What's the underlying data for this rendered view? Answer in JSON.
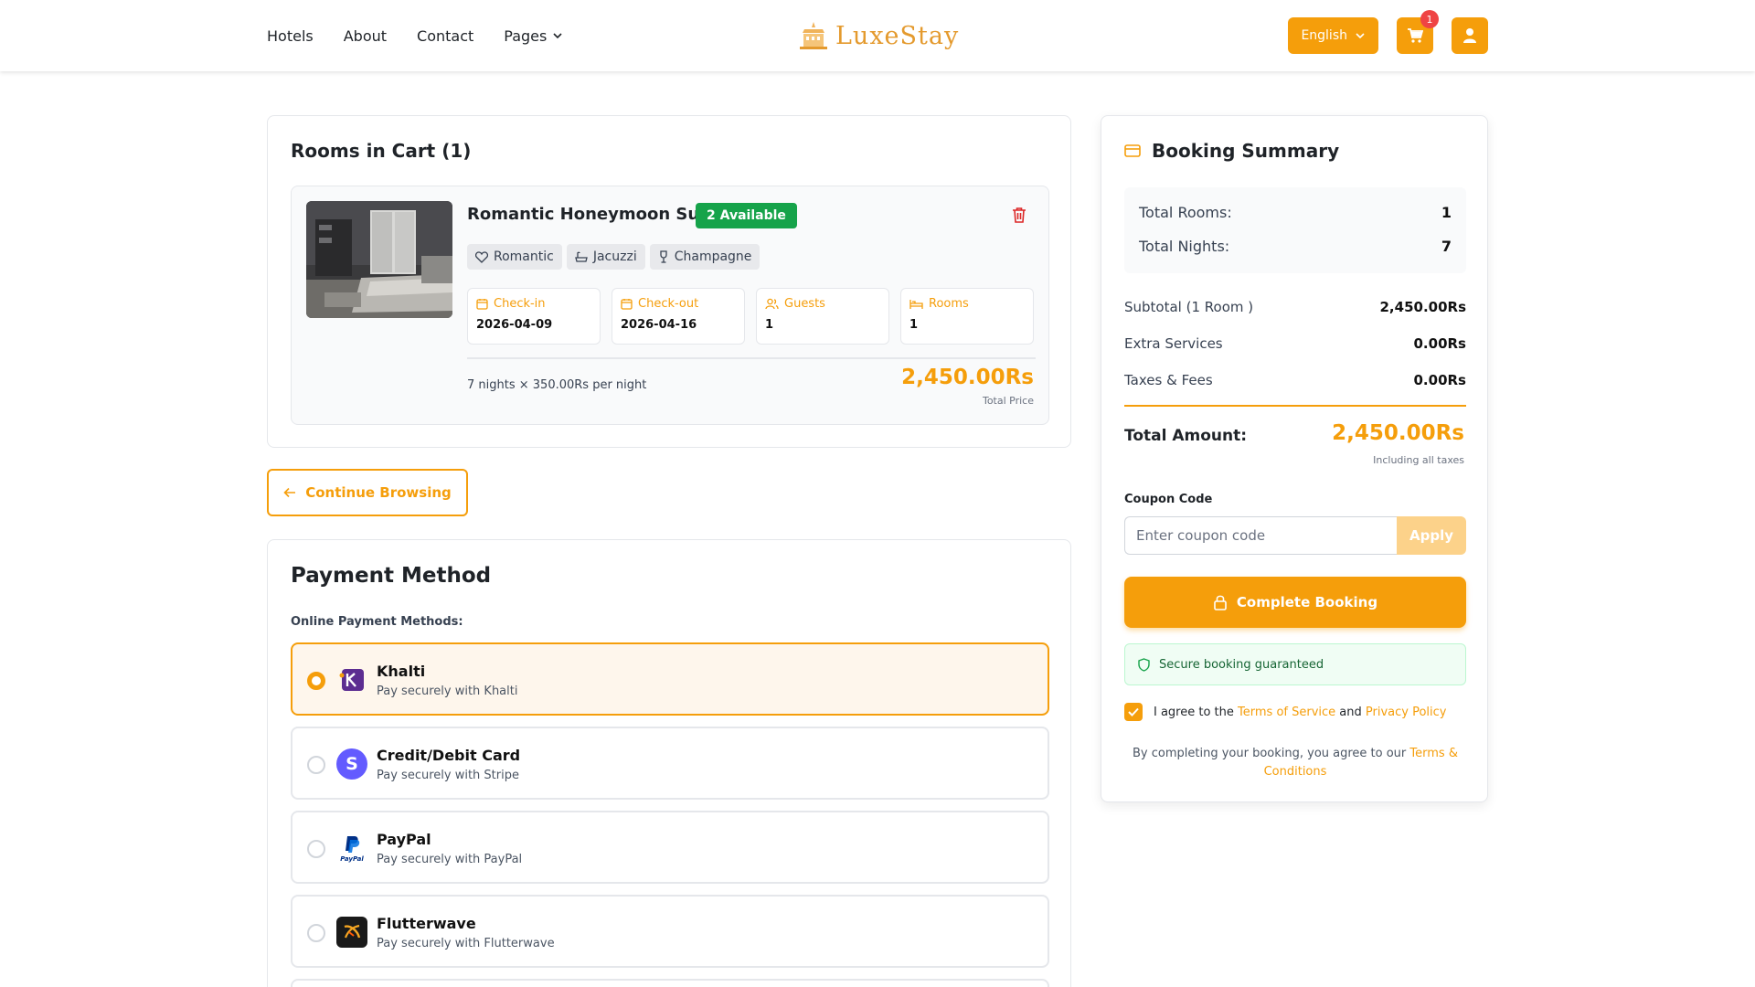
{
  "nav": {
    "items": [
      "Hotels",
      "About",
      "Contact",
      "Pages"
    ]
  },
  "logo": {
    "text": "LuxeStay"
  },
  "header": {
    "language": "English",
    "cart_count": "1"
  },
  "cart": {
    "title": "Rooms in Cart (1)",
    "room": {
      "name": "Romantic Honeymoon Suite",
      "availability": "2 Available",
      "tags": [
        "Romantic",
        "Jacuzzi",
        "Champagne"
      ],
      "stats": [
        {
          "label": "Check-in",
          "value": "2026-04-09",
          "icon": "calendar-icon"
        },
        {
          "label": "Check-out",
          "value": "2026-04-16",
          "icon": "calendar-icon"
        },
        {
          "label": "Guests",
          "value": "1",
          "icon": "users-icon"
        },
        {
          "label": "Rooms",
          "value": "1",
          "icon": "bed-icon"
        }
      ],
      "nights_text": "7 nights × 350.00Rs per night",
      "price": "2,450.00Rs",
      "price_label": "Total Price"
    }
  },
  "continue_label": "Continue Browsing",
  "payment": {
    "title": "Payment Method",
    "subtitle": "Online Payment Methods:",
    "methods": [
      {
        "name": "Khalti",
        "desc": "Pay securely with Khalti",
        "selected": true
      },
      {
        "name": "Credit/Debit Card",
        "desc": "Pay securely with Stripe",
        "selected": false
      },
      {
        "name": "PayPal",
        "desc": "Pay securely with PayPal",
        "selected": false
      },
      {
        "name": "Flutterwave",
        "desc": "Pay securely with Flutterwave",
        "selected": false
      }
    ]
  },
  "summary": {
    "title": "Booking Summary",
    "total_rooms_label": "Total Rooms:",
    "total_rooms": "1",
    "total_nights_label": "Total Nights:",
    "total_nights": "7",
    "subtotal_label": "Subtotal (1 Room )",
    "subtotal": "2,450.00Rs",
    "extra_label": "Extra Services",
    "extra": "0.00Rs",
    "taxes_label": "Taxes & Fees",
    "taxes": "0.00Rs",
    "total_label": "Total Amount:",
    "total": "2,450.00Rs",
    "total_note": "Including all taxes",
    "coupon_label": "Coupon Code",
    "coupon_placeholder": "Enter coupon code",
    "apply_label": "Apply",
    "complete_label": "Complete Booking",
    "secure_text": "Secure booking guaranteed",
    "agree_prefix": "I agree to the",
    "terms_link": "Terms of Service",
    "agree_and": "and",
    "privacy_link": "Privacy Policy",
    "fine_prefix": "By completing your booking, you agree to our",
    "fine_link": "Terms & Conditions"
  },
  "colors": {
    "accent": "#f59e0b",
    "success": "#16a34a",
    "danger": "#dc2626"
  }
}
